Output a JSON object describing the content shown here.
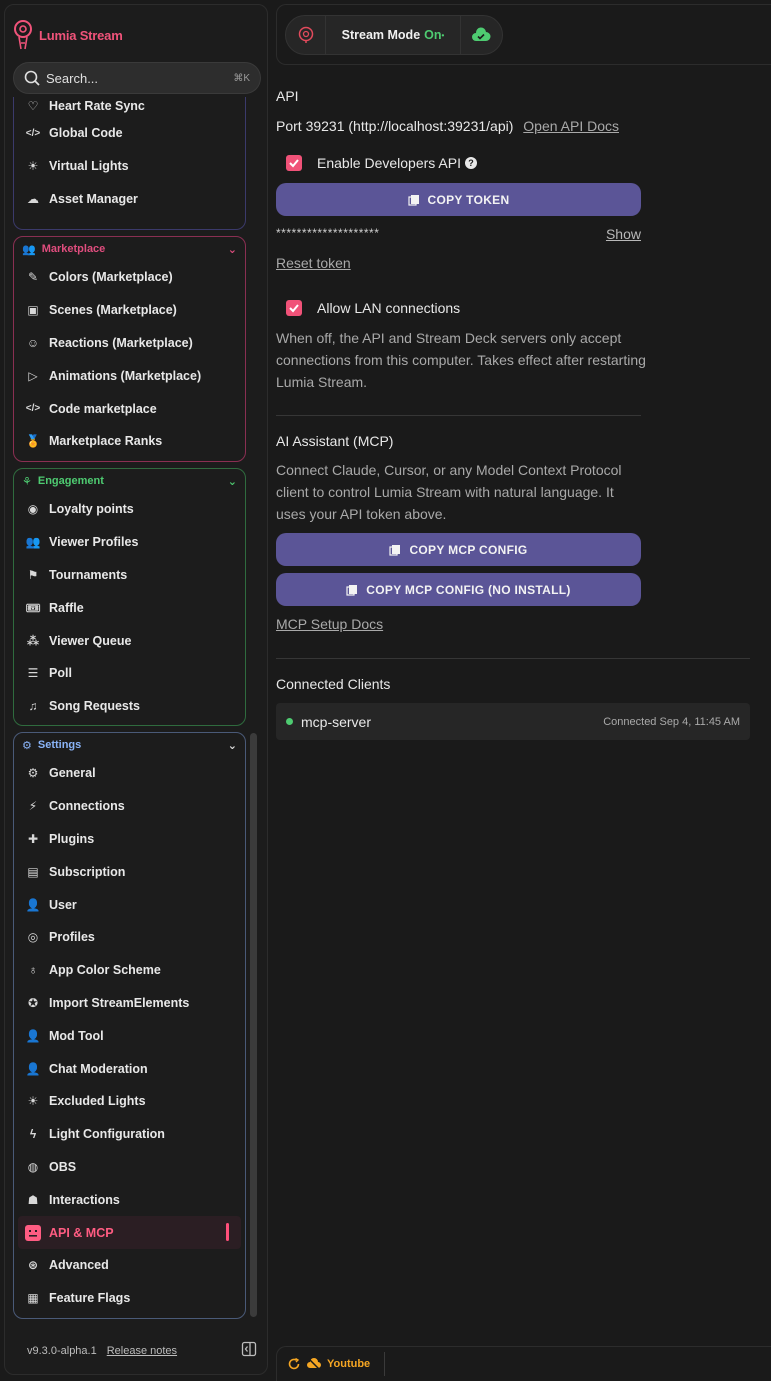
{
  "app": {
    "name": "Lumia Stream",
    "version": "v9.3.0-alpha.1",
    "release_notes": "Release notes"
  },
  "search": {
    "placeholder": "Search...",
    "shortcut": "⌘K"
  },
  "colors": {
    "accent": "#f0537a",
    "button": "#5b5597",
    "marketplace": "#e04d7e",
    "engagement": "#4ecb71",
    "settings": "#8ab4f8",
    "tools_border": "#3b3a6b"
  },
  "sidebar": {
    "tools_items": [
      {
        "label": "Heart Rate Sync",
        "icon": "heart-pulse-icon"
      },
      {
        "label": "Global Code",
        "icon": "code-icon"
      },
      {
        "label": "Virtual Lights",
        "icon": "light-bulb-icon"
      },
      {
        "label": "Asset Manager",
        "icon": "cloud-upload-icon"
      }
    ],
    "marketplace": {
      "title": "Marketplace",
      "items": [
        {
          "label": "Colors (Marketplace)",
          "icon": "eyedropper-icon"
        },
        {
          "label": "Scenes (Marketplace)",
          "icon": "image-icon"
        },
        {
          "label": "Reactions (Marketplace)",
          "icon": "emoji-icon"
        },
        {
          "label": "Animations (Marketplace)",
          "icon": "play-circle-icon"
        },
        {
          "label": "Code marketplace",
          "icon": "code-icon"
        },
        {
          "label": "Marketplace Ranks",
          "icon": "medal-icon"
        }
      ]
    },
    "engagement": {
      "title": "Engagement",
      "items": [
        {
          "label": "Loyalty points",
          "icon": "coin-icon"
        },
        {
          "label": "Viewer Profiles",
          "icon": "users-icon"
        },
        {
          "label": "Tournaments",
          "icon": "flag-icon"
        },
        {
          "label": "Raffle",
          "icon": "ticket-icon"
        },
        {
          "label": "Viewer Queue",
          "icon": "queue-icon"
        },
        {
          "label": "Poll",
          "icon": "poll-icon"
        },
        {
          "label": "Song Requests",
          "icon": "music-note-icon"
        }
      ]
    },
    "settings": {
      "title": "Settings",
      "items": [
        {
          "label": "General",
          "icon": "gear-icon"
        },
        {
          "label": "Connections",
          "icon": "plug-icon"
        },
        {
          "label": "Plugins",
          "icon": "puzzle-icon"
        },
        {
          "label": "Subscription",
          "icon": "subscription-icon"
        },
        {
          "label": "User",
          "icon": "user-icon"
        },
        {
          "label": "Profiles",
          "icon": "profile-circle-icon"
        },
        {
          "label": "App Color Scheme",
          "icon": "bulb-outline-icon"
        },
        {
          "label": "Import StreamElements",
          "icon": "streamelements-icon"
        },
        {
          "label": "Mod Tool",
          "icon": "mod-user-icon"
        },
        {
          "label": "Chat Moderation",
          "icon": "chat-mod-icon"
        },
        {
          "label": "Excluded Lights",
          "icon": "light-icon"
        },
        {
          "label": "Light Configuration",
          "icon": "bolt-icon"
        },
        {
          "label": "OBS",
          "icon": "obs-icon"
        },
        {
          "label": "Interactions",
          "icon": "robot-icon"
        },
        {
          "label": "API & MCP",
          "icon": "api-icon"
        },
        {
          "label": "Advanced",
          "icon": "advanced-icon"
        },
        {
          "label": "Feature Flags",
          "icon": "grid-icon"
        }
      ]
    }
  },
  "topbar": {
    "stream_mode_label": "Stream Mode",
    "stream_mode_state": "On"
  },
  "api": {
    "heading": "API",
    "port_text": "Port 39231 (http://localhost:39231/api)",
    "docs_link": "Open API Docs",
    "enable_label": "Enable Developers API",
    "enable_checked": true,
    "copy_token_label": "COPY TOKEN",
    "token_masked": "********************",
    "show_label": "Show",
    "reset_label": "Reset token",
    "lan_label": "Allow LAN connections",
    "lan_checked": true,
    "lan_desc": "When off, the API and Stream Deck servers only accept connections from this computer. Takes effect after restarting Lumia Stream."
  },
  "mcp": {
    "heading": "AI Assistant (MCP)",
    "desc": "Connect Claude, Cursor, or any Model Context Protocol client to control Lumia Stream with natural language. It uses your API token above.",
    "copy_config_label": "COPY MCP CONFIG",
    "copy_config_noinstall_label": "COPY MCP CONFIG (NO INSTALL)",
    "setup_docs_label": "MCP Setup Docs"
  },
  "clients": {
    "heading": "Connected Clients",
    "items": [
      {
        "name": "mcp-server",
        "status": "Connected Sep 4, 11:45 AM"
      }
    ]
  },
  "bottombar": {
    "platform": "Youtube"
  }
}
